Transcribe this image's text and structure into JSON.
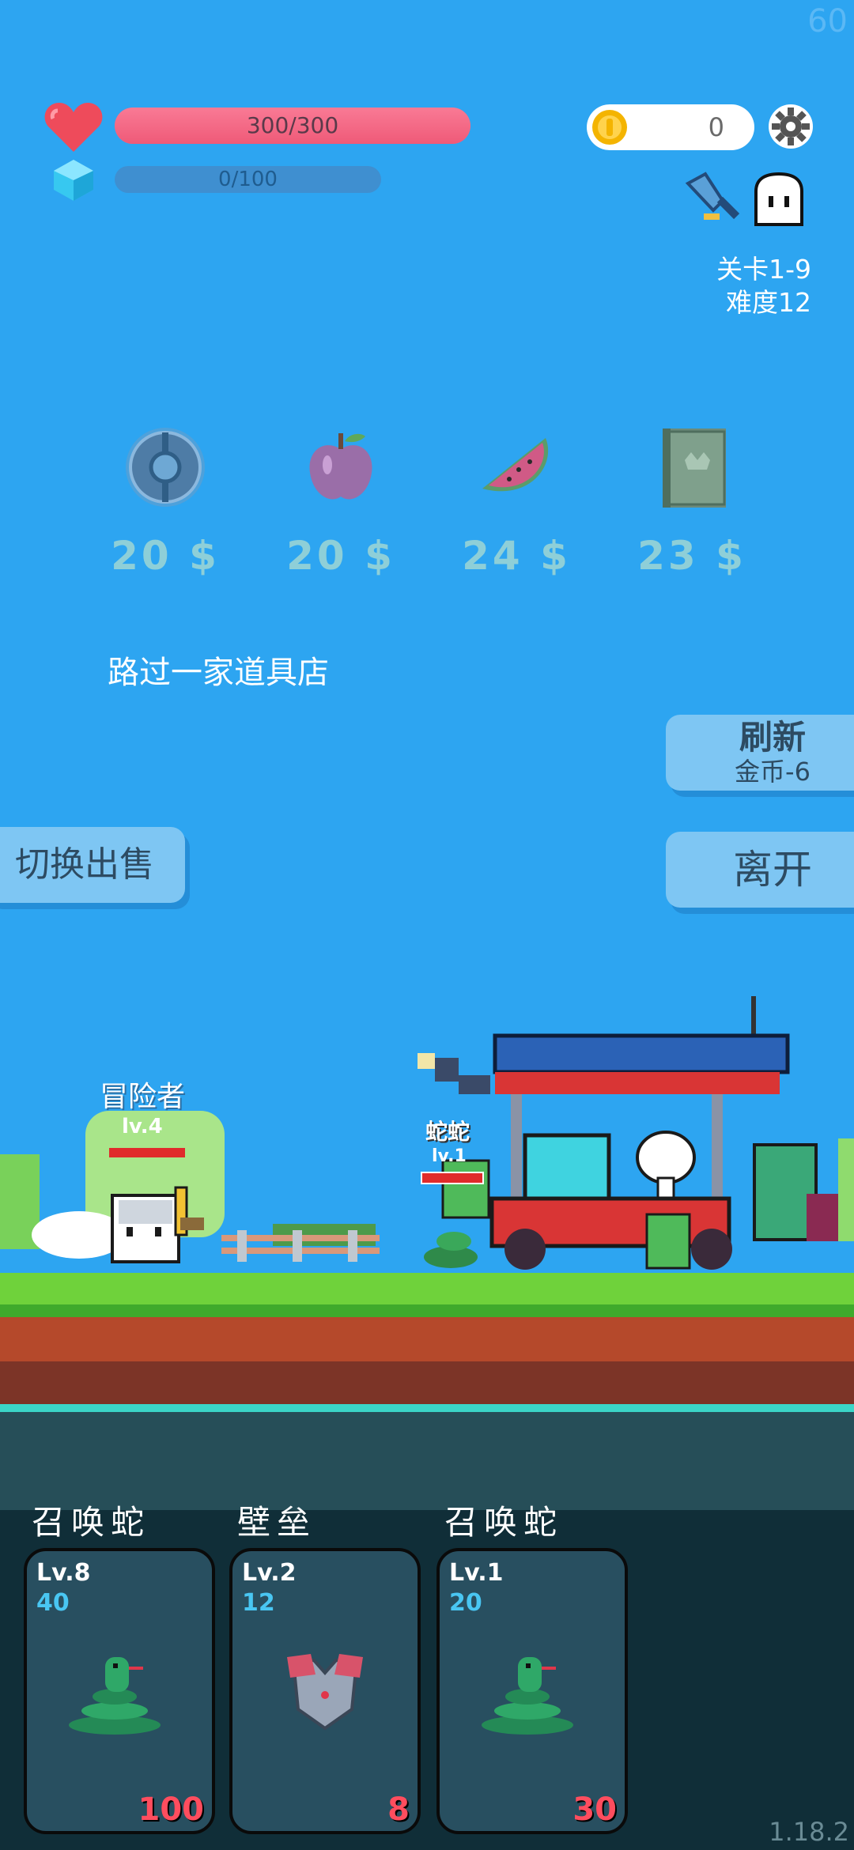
{
  "fps": "60",
  "hud": {
    "hp_text": "300/300",
    "hp_fraction": 1.0,
    "mp_text": "0/100",
    "mp_fraction": 0.0,
    "coins": "0",
    "stage": "关卡1-9",
    "difficulty": "难度12"
  },
  "shop": {
    "items": [
      {
        "icon": "shield-icon",
        "price": "20 $"
      },
      {
        "icon": "apple-icon",
        "price": "20 $"
      },
      {
        "icon": "watermelon-icon",
        "price": "24 $"
      },
      {
        "icon": "book-icon",
        "price": "23 $"
      }
    ],
    "event_text": "路过一家道具店"
  },
  "buttons": {
    "refresh_label": "刷新",
    "refresh_cost": "金币-6",
    "leave_label": "离开",
    "sell_label": "切换出售"
  },
  "battle": {
    "player_name": "冒险者",
    "player_level": "lv.4",
    "enemy_name": "蛇蛇",
    "enemy_level": "lv.1"
  },
  "cards": [
    {
      "title": "召唤蛇",
      "level": "Lv.8",
      "cost": "40",
      "power": "100",
      "icon": "snake-icon"
    },
    {
      "title": "壁垒",
      "level": "Lv.2",
      "cost": "12",
      "power": "8",
      "icon": "armor-icon"
    },
    {
      "title": "召唤蛇",
      "level": "Lv.1",
      "cost": "20",
      "power": "30",
      "icon": "snake-icon"
    }
  ],
  "version": "1.18.2",
  "colors": {
    "sky": "#2da5f1",
    "hp": "#f56a86",
    "button": "#7ec6f3",
    "card_bg": "#284f60",
    "card_power": "#ff4d5e"
  }
}
